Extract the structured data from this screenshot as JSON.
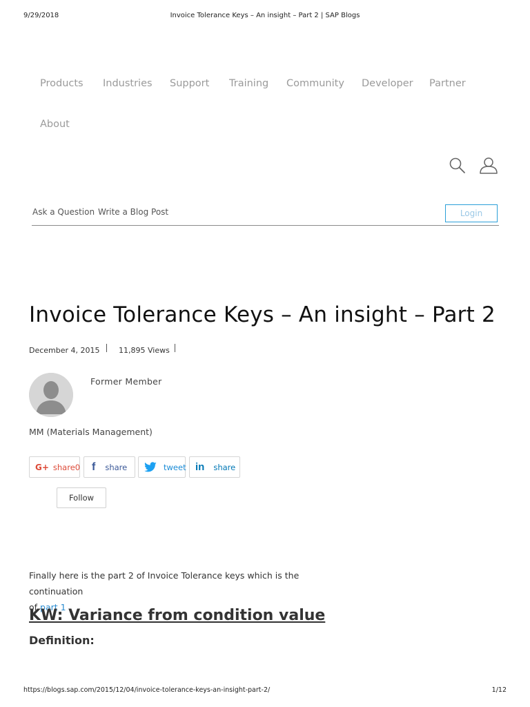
{
  "print_header": {
    "date": "9/29/2018",
    "title": "Invoice Tolerance Keys – An insight – Part 2 | SAP Blogs"
  },
  "print_footer": {
    "url": "https://blogs.sap.com/2015/12/04/invoice-tolerance-keys-an-insight-part-2/",
    "page": "1/12"
  },
  "nav": {
    "items": [
      "Products",
      "Industries",
      "Support",
      "Training",
      "Community",
      "Developer",
      "Partner",
      "About"
    ]
  },
  "icons": {
    "search": "search-icon",
    "user": "user-icon"
  },
  "subnav": {
    "ask": "Ask a Question",
    "write": "Write a Blog Post",
    "login": "Login"
  },
  "article": {
    "title": "Invoice Tolerance Keys – An insight – Part 2",
    "date": "December 4, 2015",
    "views": "11,895 Views",
    "author": "Former Member",
    "category": "MM (Materials Management)",
    "share": {
      "google": "share",
      "google_count": "0",
      "facebook": "share",
      "twitter": "tweet",
      "linkedin": "share"
    },
    "follow": "Follow",
    "intro_line1": "Finally here is the part 2 of Invoice Tolerance keys which is the continuation",
    "intro_of": "of",
    "intro_link": "part 1",
    "intro_end": ".",
    "heading": "KW: Variance from condition value",
    "subheading": "Definition:"
  },
  "colors": {
    "accent": "#2a9fd8",
    "link": "#2a8bd0",
    "google": "#dd4b39",
    "facebook": "#3b5998",
    "twitter": "#1da1f2",
    "linkedin": "#0077b5"
  }
}
